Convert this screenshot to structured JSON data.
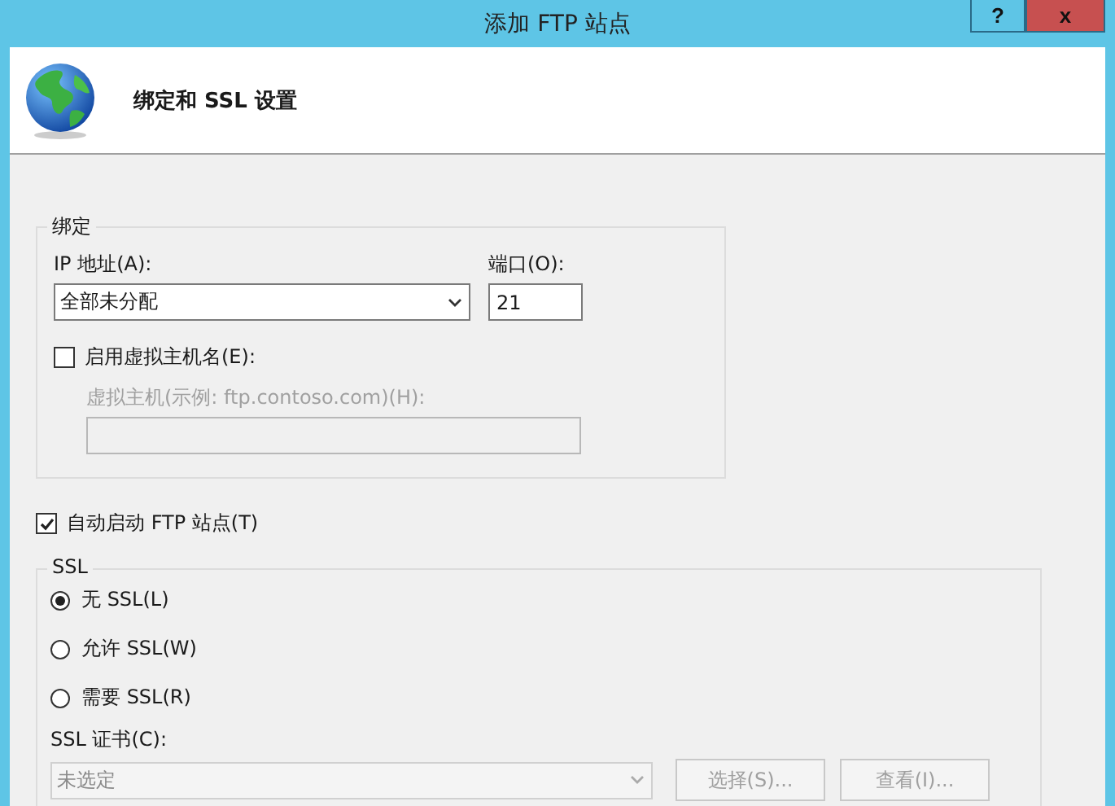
{
  "window": {
    "title": "添加 FTP 站点",
    "help_button": "?",
    "close_button": "x"
  },
  "header": {
    "title": "绑定和 SSL 设置"
  },
  "binding": {
    "legend": "绑定",
    "ip_label": "IP 地址(A):",
    "ip_value": "全部未分配",
    "port_label": "端口(O):",
    "port_value": "21",
    "virtual_host": {
      "label": "启用虚拟主机名(E):",
      "checked": false
    },
    "host_label": "虚拟主机(示例: ftp.contoso.com)(H):",
    "host_disabled": true
  },
  "auto_start": {
    "label": "自动启动 FTP 站点(T)",
    "checked": true
  },
  "ssl": {
    "legend": "SSL",
    "options": [
      {
        "label": "无 SSL(L)",
        "selected": true
      },
      {
        "label": "允许 SSL(W)",
        "selected": false
      },
      {
        "label": "需要 SSL(R)",
        "selected": false
      }
    ],
    "cert_label": "SSL 证书(C):",
    "cert_value": "未选定",
    "cert_disabled": true,
    "buttons": [
      {
        "label": "选择(S)...",
        "disabled": true
      },
      {
        "label": "查看(I)...",
        "disabled": true
      }
    ]
  }
}
